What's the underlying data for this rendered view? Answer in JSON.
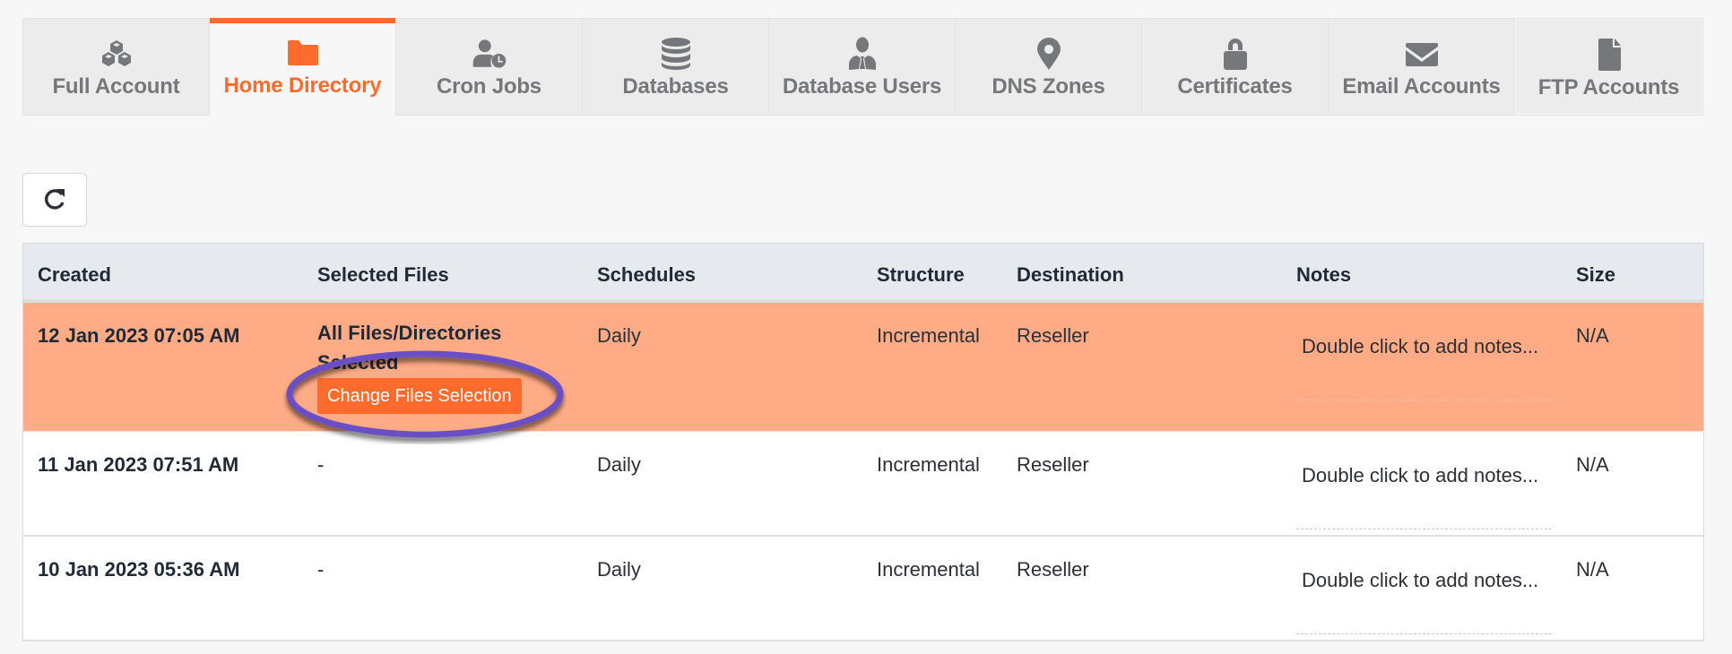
{
  "tabs": [
    {
      "label": "Full Account",
      "icon": "cubes-icon",
      "active": false
    },
    {
      "label": "Home Directory",
      "icon": "folder-icon",
      "active": true
    },
    {
      "label": "Cron Jobs",
      "icon": "user-clock-icon",
      "active": false
    },
    {
      "label": "Databases",
      "icon": "database-icon",
      "active": false
    },
    {
      "label": "Database Users",
      "icon": "user-tie-icon",
      "active": false
    },
    {
      "label": "DNS Zones",
      "icon": "map-marker-icon",
      "active": false
    },
    {
      "label": "Certificates",
      "icon": "lock-icon",
      "active": false
    },
    {
      "label": "Email Accounts",
      "icon": "envelope-icon",
      "active": false
    },
    {
      "label": "FTP Accounts",
      "icon": "file-icon",
      "active": false
    }
  ],
  "toolbar": {
    "refresh_icon": "refresh-icon"
  },
  "table": {
    "columns": [
      "Created",
      "Selected Files",
      "Schedules",
      "Structure",
      "Destination",
      "Notes",
      "Size"
    ],
    "rows": [
      {
        "created": "12 Jan 2023 07:05 AM",
        "selected_files": "All Files/Directories Selected",
        "change_button": "Change Files Selection",
        "schedules": "Daily",
        "structure": "Incremental",
        "destination": "Reseller",
        "notes": "Double click to add notes...",
        "size": "N/A",
        "highlighted": true
      },
      {
        "created": "11 Jan 2023 07:51 AM",
        "selected_files": "-",
        "schedules": "Daily",
        "structure": "Incremental",
        "destination": "Reseller",
        "notes": "Double click to add notes...",
        "size": "N/A",
        "highlighted": false
      },
      {
        "created": "10 Jan 2023 05:36 AM",
        "selected_files": "-",
        "schedules": "Daily",
        "structure": "Incremental",
        "destination": "Reseller",
        "notes": "Double click to add notes...",
        "size": "N/A",
        "highlighted": false
      }
    ]
  },
  "colors": {
    "accent": "#ff6b2c",
    "highlight_row": "#ffab85",
    "annotation": "#6a4fc4",
    "tab_text": "#76777b",
    "header_bg": "#e6eaee"
  }
}
